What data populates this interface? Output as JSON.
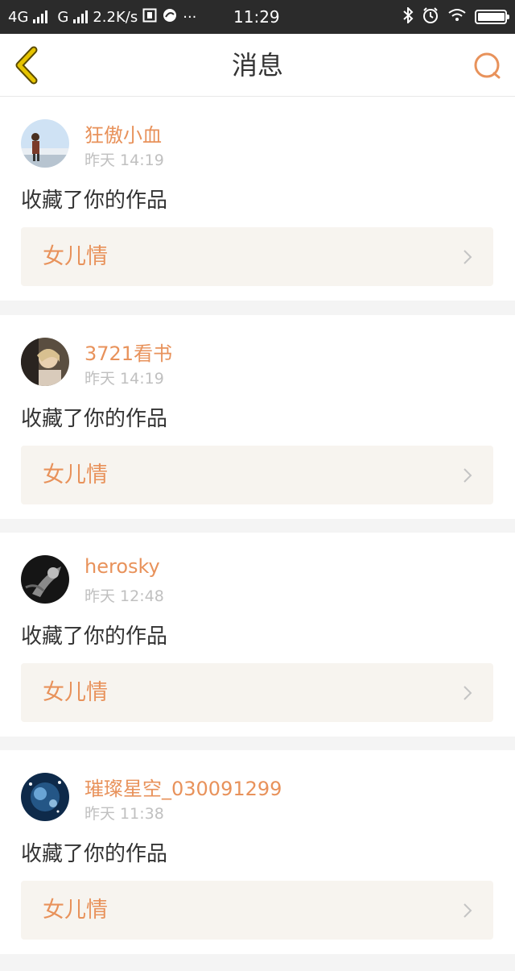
{
  "status_bar": {
    "network_1": "4G",
    "network_2": "G",
    "speed": "2.2K/s",
    "more": "···",
    "time": "11:29"
  },
  "nav": {
    "title": "消息",
    "back_icon": "chevron-left-icon",
    "search_icon": "search-icon"
  },
  "colors": {
    "accent": "#e8925b",
    "back_icon": "#c8a400",
    "work_box_bg": "#f7f4ef"
  },
  "messages": [
    {
      "username": "狂傲小血",
      "time": "昨天 14:19",
      "action": "收藏了你的作品",
      "work_title": "女儿情"
    },
    {
      "username": "3721看书",
      "time": "昨天 14:19",
      "action": "收藏了你的作品",
      "work_title": "女儿情"
    },
    {
      "username": "herosky",
      "time": "昨天 12:48",
      "action": "收藏了你的作品",
      "work_title": "女儿情"
    },
    {
      "username": "璀璨星空_030091299",
      "time": "昨天 11:38",
      "action": "收藏了你的作品",
      "work_title": "女儿情"
    }
  ]
}
